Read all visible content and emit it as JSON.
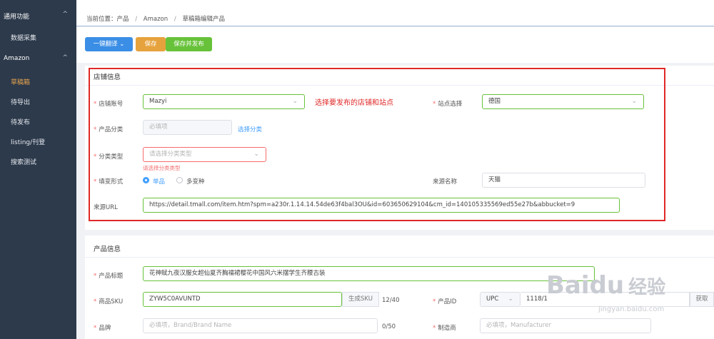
{
  "sidebar": {
    "groups": [
      {
        "label": "通用功能",
        "chevron": "^"
      },
      {
        "label": "Amazon",
        "chevron": "^"
      }
    ],
    "items": [
      {
        "label": "数据采集"
      },
      {
        "label": "草稿箱"
      },
      {
        "label": "待导出"
      },
      {
        "label": "待发布"
      },
      {
        "label": "listing/刊登"
      },
      {
        "label": "搜索测试"
      }
    ]
  },
  "breadcrumb": {
    "prefix": "当前位置：产品",
    "sep": "/",
    "level2": "Amazon",
    "level3": "草稿箱编辑产品"
  },
  "toolbar": {
    "translate_label": "一键翻译",
    "translate_caret": "⌄",
    "save_label": "保存",
    "save_publish_label": "保存并发布"
  },
  "store_info": {
    "title": "店铺信息",
    "annotation": "选择要发布的店铺和站点",
    "store_account_label": "店铺账号",
    "store_account_value": "Mazyi",
    "site_label": "站点选择",
    "site_value": "德国",
    "category_label": "产品分类",
    "category_placeholder": "必填项",
    "category_link": "选择分类",
    "category_type_label": "分类类型",
    "category_type_placeholder": "请选择分类类型",
    "category_type_error": "请选择分类类型",
    "variant_label": "填变形式",
    "variant_option_single": "单品",
    "variant_option_multi": "多变种",
    "source_name_label": "来源名称",
    "source_name_value": "天猫",
    "source_url_label": "来源URL",
    "source_url_value": "https://detail.tmall.com/item.htm?spm=a230r.1.14.14.54de63f4bal3OU&id=603650629104&cm_id=140105335569ed55e27b&abbucket=9"
  },
  "product_info": {
    "title": "产品信息",
    "title_label": "产品标题",
    "title_value": "花神赋九夜汉服女超仙夏齐胸襦裙樱花中国风六米摆学生齐腰古装",
    "sku_label": "商品SKU",
    "sku_value": "ZYW5C0AVUNTD",
    "sku_button": "生成SKU",
    "sku_count": "12/40",
    "product_id_label": "产品ID",
    "product_id_type": "UPC",
    "product_id_value": "1118/1",
    "product_id_button": "获取",
    "brand_label": "品牌",
    "brand_placeholder": "必填项，Brand/Brand Name",
    "brand_count": "0/50",
    "manufacturer_label": "制造商",
    "manufacturer_placeholder": "必填项，Manufacturer"
  },
  "watermark": {
    "brand": "Baidu",
    "cn": "经验",
    "url": "jingyan.baidu.com"
  },
  "colors": {
    "sidebar_bg": "#2d3a4b",
    "active_item": "#e8a44d",
    "primary": "#3a8ee6",
    "warning": "#e6a23c",
    "success": "#67c23a",
    "annotation": "#e02828"
  }
}
